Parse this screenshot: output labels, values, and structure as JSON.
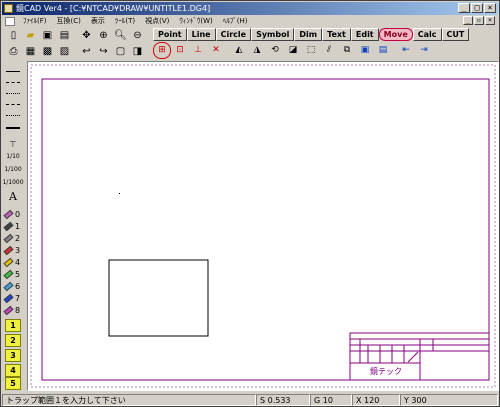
{
  "window": {
    "title": "鏡CAD Ver4 - [C:¥NTCAD¥DRAW¥UNTITLE1.DG4]"
  },
  "menu": [
    "ﾌｧｲﾙ(F)",
    "互換(C)",
    "表示",
    "ﾂｰﾙ(T)",
    "視点(V)",
    "ｳｨﾝﾄﾞｳ(W)",
    "ﾍﾙﾌﾟ(H)"
  ],
  "window_buttons": [
    "_",
    "□",
    "×"
  ],
  "mdi_buttons": [
    "_",
    "▫",
    "×"
  ],
  "tabs": [
    "Point",
    "Line",
    "Circle",
    "Symbol",
    "Dim",
    "Text",
    "Edit",
    "Move",
    "Calc",
    "CUT"
  ],
  "active_tab": "Move",
  "left_labels": {
    "scale_a": "1/10",
    "scale_b": "1/100",
    "scale_c": "1/1000",
    "text_tool": "A"
  },
  "pens": [
    "0",
    "1",
    "2",
    "3",
    "4",
    "5",
    "6",
    "7",
    "8"
  ],
  "pen_colors": [
    "#c060c0",
    "#404040",
    "#808080",
    "#d03030",
    "#e0c000",
    "#40c040",
    "#40a0e0",
    "#2040d0",
    "#c040c0"
  ],
  "layers": [
    "1",
    "2",
    "3",
    "4",
    "5"
  ],
  "title_block": {
    "company": "鏡テック"
  },
  "status": {
    "prompt": "トラップ範囲１を入力して下さい",
    "s": "S 0.533",
    "g": "G 10",
    "x": "X 120",
    "y": "Y 300"
  },
  "colors": {
    "frame": "#800080",
    "title_active_tab": "#f4b8c4"
  }
}
